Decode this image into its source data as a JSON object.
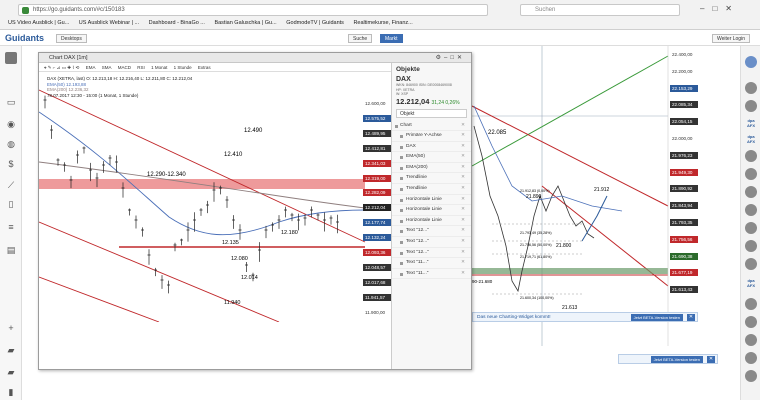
{
  "browser": {
    "url": "https://go.guidants.com/#c/150183",
    "search_placeholder": "Suchen",
    "bookmarks": [
      "US Video Ausblick | Gu...",
      "US Ausblick Webinar | ...",
      "Dashboard - BinaGo ...",
      "Bastian Galuschka | Gu...",
      "GodmodeTV | Guidants",
      "Realtimekurse, Finanz..."
    ]
  },
  "app": {
    "logo": "Guidants",
    "back_label": "Desktops",
    "search_label": "Suche",
    "market_label": "Markt",
    "login_label": "Weiter Login"
  },
  "chart_window": {
    "title": "Chart DAX [1m]",
    "toolbar": [
      "EMA",
      "SMA",
      "MACD",
      "RSI",
      "1 Monat",
      "1 Stunde",
      "Extras"
    ],
    "ticker_line1": "DAX (XETRA, last)  O: 12.213,18  H: 12.216,40  L: 12.211,80  C: 12.212,04",
    "ticker_line2": "EMA(50)  12.193,88",
    "ticker_line3": "EMA(200)  12.236,32",
    "ticker_line4": "78.07.2017 12:30 - 15:00  (1 Monat, 1 Stunde)",
    "price_axis": [
      "12.600,00",
      "12.575,52",
      "12.489,95",
      "12.412,81",
      "12.341,03",
      "12.319,00",
      "12.282,09",
      "12.212,04",
      "12.177,74",
      "12.132,24",
      "12.093,36",
      "12.048,57",
      "12.017,68",
      "11.941,57",
      "11.900,00"
    ],
    "annotations": [
      "12.490",
      "12.410",
      "12.290-12.340",
      "12.135",
      "12.180",
      "12.080",
      "12.014",
      "11.940"
    ],
    "banner_text": "Das neue Charting-Widget kommt!",
    "banner_button": "Jetzt BETA-Version testen"
  },
  "objekte": {
    "header": "Objekte",
    "symbol": "DAX",
    "meta1": "WKN: 846900  ISIN: DE0008469008",
    "meta2": "HP: XETRA",
    "meta3": "W: XSP",
    "price": "12.212,04",
    "change": "31,24  0,26%",
    "tab": "Objekt",
    "items": [
      "Chart",
      "Primäre Y-Achse",
      "DAX",
      "EMA(50)",
      "EMA(200)",
      "Trendlinie",
      "Trendlinie",
      "Horizontale Linie",
      "Horizontale Linie",
      "Horizontale Linie",
      "Text \"12...\"",
      "Text \"12...\"",
      "Text \"12...\"",
      "Text \"11...\"",
      "Text \"11...\""
    ]
  },
  "back_chart": {
    "price_axis": [
      "22.400,00",
      "22.200,00",
      "22.153,29",
      "22.085,34",
      "22.054,15",
      "22.000,00",
      "21.976,23",
      "21.949,30",
      "21.890,92",
      "21.843,94",
      "21.793,35",
      "21.756,56",
      "21.690,38",
      "21.677,19",
      "21.613,43"
    ],
    "annotations": [
      "22.085",
      "21.912",
      "21.890",
      "21.800",
      "21.613",
      "21.912,83 (0,00%)",
      "21.793,49 (35,28%)",
      "21.756,56 (50,00%)",
      "21.719,71 (61,80%)",
      "21.600,34 (100,00%)",
      "90-21.680"
    ],
    "lower_value": "5.500,00",
    "banner_text": "Das neue Charting-Widget kommt!",
    "banner_button": "Jetzt BETA-Version testen"
  },
  "colors": {
    "accent": "#2b5a9a",
    "resistance": "#e8787a",
    "support": "#c0282b",
    "ema50": "#4a6fb8",
    "ema200": "#8f7f7f"
  }
}
